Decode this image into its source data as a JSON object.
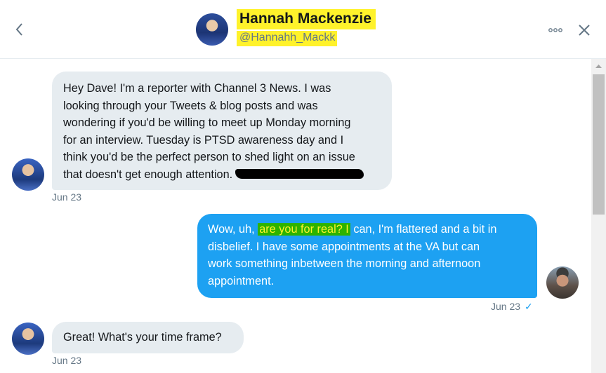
{
  "header": {
    "name": "Hannah Mackenzie",
    "handle": "@Hannahh_Mackk",
    "back_icon": "chevron-left-icon",
    "more_icon": "more-horizontal-icon",
    "close_icon": "close-icon"
  },
  "messages": [
    {
      "direction": "incoming",
      "lines": [
        "Hey Dave! I'm a reporter with Channel 3 News. I was",
        "looking through your Tweets & blog posts and was",
        "wondering if you'd be willing to meet up Monday morning",
        "for an interview. Tuesday is PTSD awareness day and I",
        "think you'd be the perfect person to shed light on an issue",
        "that doesn't get enough attention."
      ],
      "redacted": true,
      "time": "Jun 23"
    },
    {
      "direction": "outgoing",
      "line1_pre": "Wow, uh,",
      "line1_highlight": "are you for real? I",
      "line1_post": "can, I'm flattered and a bit in",
      "lines": [
        "disbelief. I have some appointments at the VA but can",
        "work something inbetween the morning and afternoon",
        "appointment."
      ],
      "time": "Jun 23",
      "check": "✓"
    },
    {
      "direction": "incoming",
      "lines": [
        "Great! What's your time frame?"
      ],
      "time": "Jun 23"
    }
  ],
  "colors": {
    "incoming_bubble": "#e6ecf0",
    "outgoing_bubble": "#1da1f2",
    "highlight_yellow": "#fff22b",
    "highlight_green": "#2db300"
  }
}
